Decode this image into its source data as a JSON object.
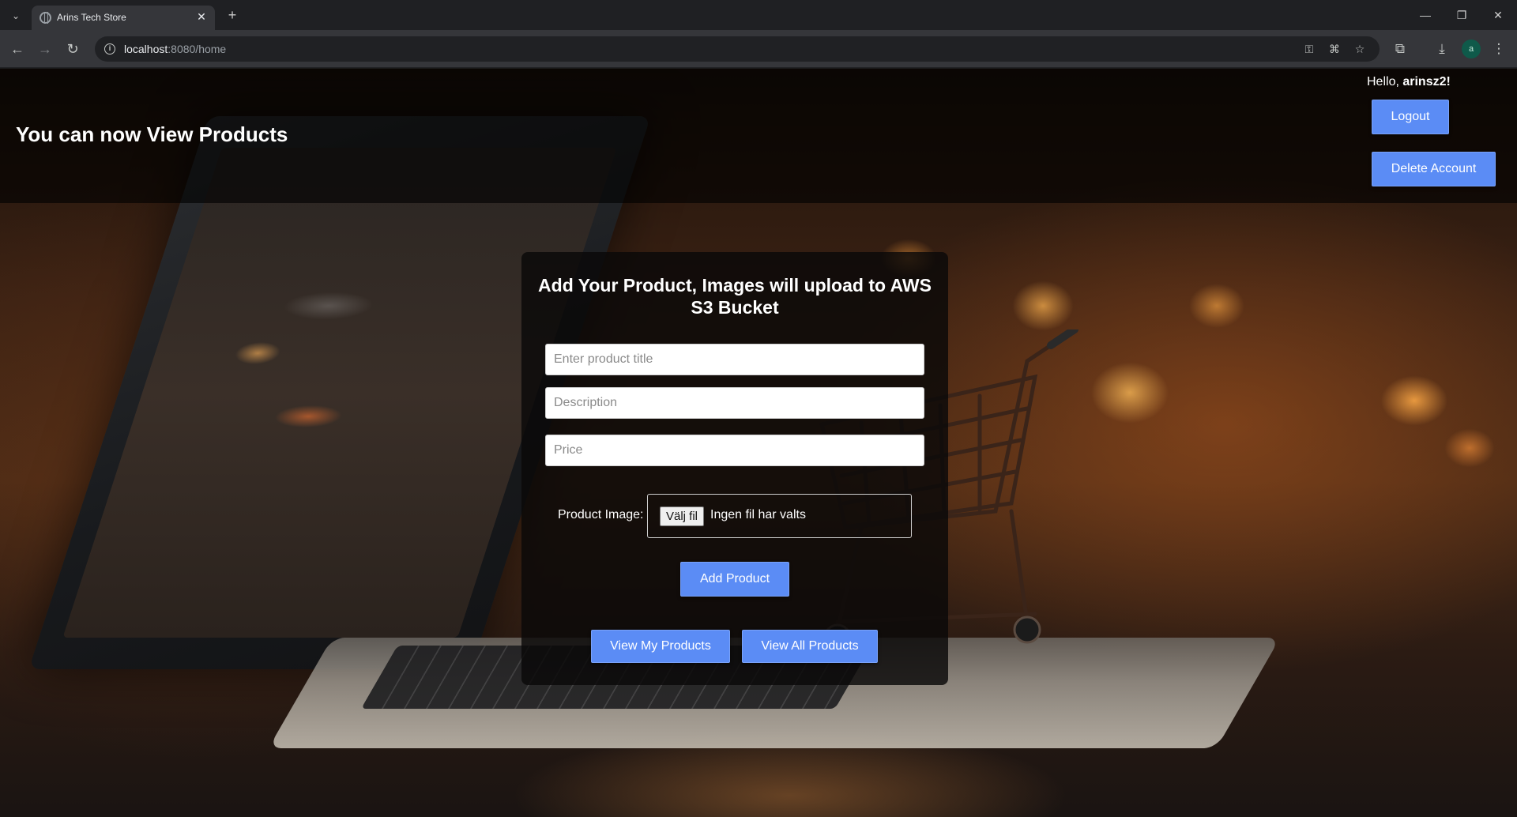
{
  "browser": {
    "tab_title": "Arins Tech Store",
    "tab_close": "✕",
    "new_tab": "+",
    "url_host": "localhost",
    "url_path": ":8080/home",
    "profile_initial": "a",
    "icons": [
      "tab-menu-icon",
      "back-icon",
      "forward-icon",
      "reload-icon",
      "info-icon",
      "key-icon",
      "translate-icon",
      "star-icon",
      "extensions-icon",
      "download-icon",
      "more-icon",
      "minimize-icon",
      "restore-icon",
      "close-icon"
    ]
  },
  "header": {
    "title": "You can now View Products",
    "greeting_prefix": "Hello, ",
    "username": "arinsz2!",
    "logout_label": "Logout",
    "delete_label": "Delete Account"
  },
  "form": {
    "heading": "Add Your Product, Images will upload to AWS S3 Bucket",
    "title_placeholder": "Enter product title",
    "description_placeholder": "Description",
    "price_placeholder": "Price",
    "image_label": "Product Image:",
    "file_button": "Välj fil",
    "file_status": "Ingen fil har valts",
    "add_label": "Add Product",
    "view_mine_label": "View My Products",
    "view_all_label": "View All Products"
  },
  "colors": {
    "button": "#5b8cf5",
    "header_overlay": "rgba(0,0,0,0.62)",
    "panel": "rgba(10,8,8,0.82)"
  }
}
